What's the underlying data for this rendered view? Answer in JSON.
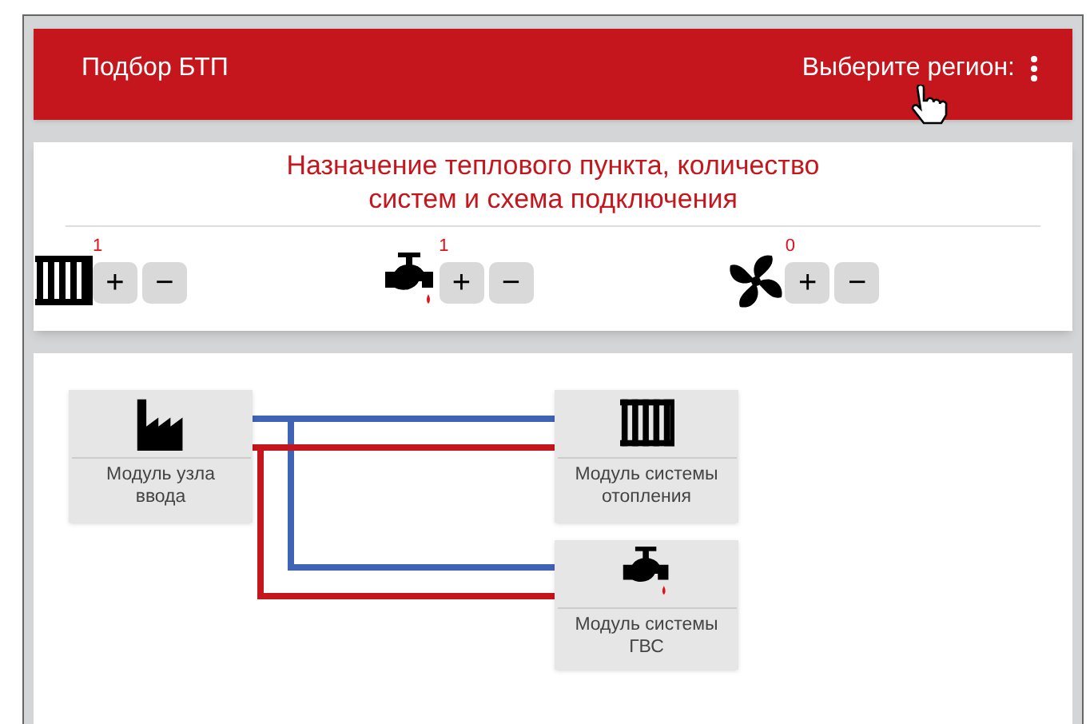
{
  "header": {
    "title": "Подбор БТП",
    "region_label": "Выберите регион:"
  },
  "purpose": {
    "title": "Назначение теплового пункта, количество систем и схема подключения",
    "counters": [
      {
        "kind": "radiator",
        "count": "1",
        "plus": "+",
        "minus": "−"
      },
      {
        "kind": "tap",
        "count": "1",
        "plus": "+",
        "minus": "−"
      },
      {
        "kind": "fan",
        "count": "0",
        "plus": "+",
        "minus": "−"
      }
    ]
  },
  "diagram": {
    "modules": [
      {
        "kind": "factory",
        "label": "Модуль узла ввода"
      },
      {
        "kind": "radiator",
        "label": "Модуль системы отопления"
      },
      {
        "kind": "tap",
        "label": "Модуль системы ГВС"
      }
    ],
    "pipes": [
      {
        "color": "#3f63b5"
      },
      {
        "color": "#c4161c"
      },
      {
        "color": "#3f63b5"
      },
      {
        "color": "#c4161c"
      }
    ]
  }
}
